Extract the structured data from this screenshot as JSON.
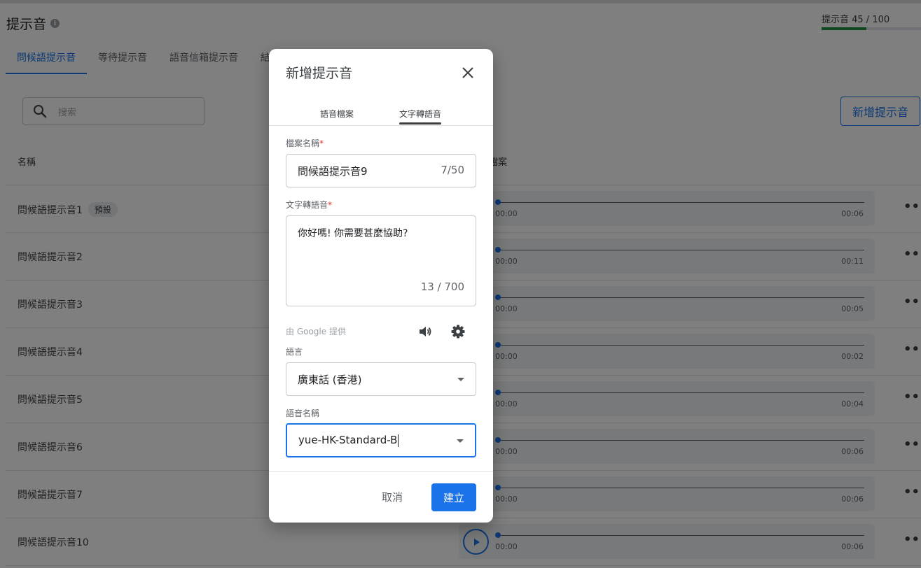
{
  "page": {
    "title": "提示音",
    "quota_text": "提示音 45 / 100",
    "quota_used": 45,
    "quota_total": 100,
    "tabs": [
      "問候語提示音",
      "等待提示音",
      "語音信箱提示音",
      "結"
    ],
    "active_tab": 0,
    "search_placeholder": "搜索",
    "add_button": "新增提示音",
    "col_name": "名稱",
    "col_file": "檔案",
    "rows": [
      {
        "name": "問候語提示音1",
        "badge": "預設",
        "start": "00:00",
        "end": "00:06"
      },
      {
        "name": "問候語提示音2",
        "badge": "",
        "start": "00:00",
        "end": "00:11"
      },
      {
        "name": "問候語提示音3",
        "badge": "",
        "start": "00:00",
        "end": "00:05"
      },
      {
        "name": "問候語提示音4",
        "badge": "",
        "start": "00:00",
        "end": "00:02"
      },
      {
        "name": "問候語提示音5",
        "badge": "",
        "start": "00:00",
        "end": "00:04"
      },
      {
        "name": "問候語提示音6",
        "badge": "",
        "start": "00:00",
        "end": "00:06"
      },
      {
        "name": "問候語提示音7",
        "badge": "",
        "start": "00:00",
        "end": "00:06"
      },
      {
        "name": "問候語提示音10",
        "badge": "",
        "start": "00:00",
        "end": "00:06"
      }
    ],
    "more_glyph": "•••"
  },
  "dialog": {
    "title": "新增提示音",
    "tabs": [
      "語音檔案",
      "文字轉語音"
    ],
    "active_tab": 1,
    "filename_label": "檔案名稱",
    "filename_value": "問候語提示音9",
    "filename_count": "7/50",
    "tts_label": "文字轉語音",
    "tts_value": "你好嗎! 你需要甚麼協助?",
    "tts_count": "13 / 700",
    "google_text": "由 Google 提供",
    "language_label": "語言",
    "language_value": "廣東話 (香港)",
    "voice_label": "語音名稱",
    "voice_value": "yue-HK-Standard-B",
    "cancel": "取消",
    "create": "建立",
    "required_mark": "*"
  },
  "colors": {
    "accent": "#1a73e8",
    "quota": "#1e8e3e",
    "required": "#d93025"
  }
}
